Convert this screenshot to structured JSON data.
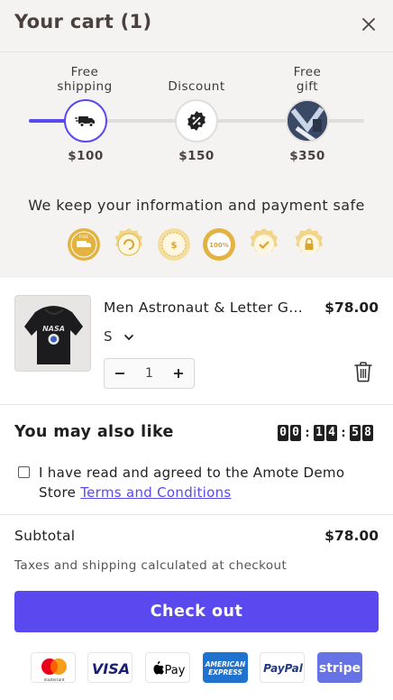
{
  "header": {
    "title": "Your cart (1)",
    "close_icon": "close-icon"
  },
  "shipping_progress": {
    "progress_fraction": 0.17,
    "accent_color": "#5b49f0",
    "milestones": [
      {
        "label_line1": "Free",
        "label_line2": "shipping",
        "price": "$100",
        "icon": "truck-icon",
        "reached": true
      },
      {
        "label_line1": "Discount",
        "label_line2": "",
        "price": "$150",
        "icon": "percent-badge-icon",
        "reached": false
      },
      {
        "label_line1": "Free",
        "label_line2": "gift",
        "price": "$350",
        "icon": "gift-product-image",
        "reached": false
      }
    ]
  },
  "trust": {
    "text": "We keep your information and payment safe",
    "badges": [
      "free-shipping-badge-icon",
      "easy-returns-badge-icon",
      "money-back-badge-icon",
      "premium-quality-badge-icon",
      "satisfaction-guaranteed-badge-icon",
      "secure-checkout-badge-icon"
    ]
  },
  "cart_item": {
    "name": "Men Astronaut & Letter Graphic Hoodie",
    "price": "$78.00",
    "variant": "S",
    "quantity": "1",
    "image_text": "NASA"
  },
  "upsell": {
    "title": "You may also like",
    "timer": {
      "m1": "0",
      "m2": "0",
      "s1": "1",
      "s2": "4",
      "t1": "5",
      "t2": "8"
    }
  },
  "terms": {
    "text": "I have read and agreed to the Amote Demo Store ",
    "link": "Terms and Conditions",
    "checked": false
  },
  "summary": {
    "subtotal_label": "Subtotal",
    "subtotal_value": "$78.00",
    "taxes_note": "Taxes and shipping calculated at checkout"
  },
  "checkout": {
    "label": "Check out",
    "color": "#5b49f0"
  },
  "payment_methods": {
    "mastercard_label": "mastercard",
    "visa_label": "VISA",
    "applepay_label": "Pay",
    "amex_line1": "AMERICAN",
    "amex_line2": "EXPRESS",
    "paypal_label": "PayPal",
    "stripe_label": "stripe"
  }
}
